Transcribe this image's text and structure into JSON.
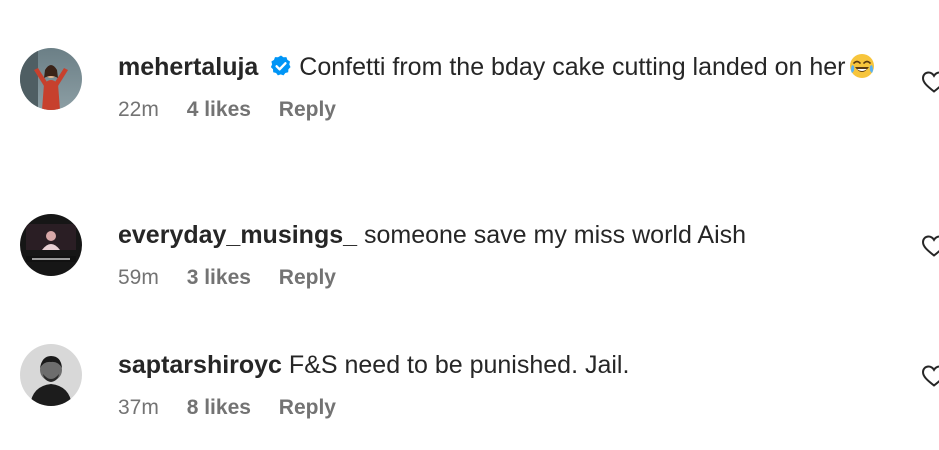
{
  "comments": [
    {
      "username": "mehertaluja",
      "verified": true,
      "text": "Confetti from the bday cake cutting landed on her",
      "emoji": "face-with-tears-of-joy-icon",
      "time": "22m",
      "likes": "4 likes",
      "reply": "Reply"
    },
    {
      "username": "everyday_musings_",
      "verified": false,
      "text": "someone save my miss world Aish",
      "time": "59m",
      "likes": "3 likes",
      "reply": "Reply"
    },
    {
      "username": "saptarshiroyc",
      "verified": false,
      "text": "F&S need to be punished. Jail.",
      "time": "37m",
      "likes": "8 likes",
      "reply": "Reply"
    }
  ],
  "colors": {
    "text": "#262626",
    "secondary": "#737373",
    "verified": "#0095f6"
  },
  "icons": {
    "like": "heart-outline-icon",
    "verified": "verified-badge-icon"
  }
}
